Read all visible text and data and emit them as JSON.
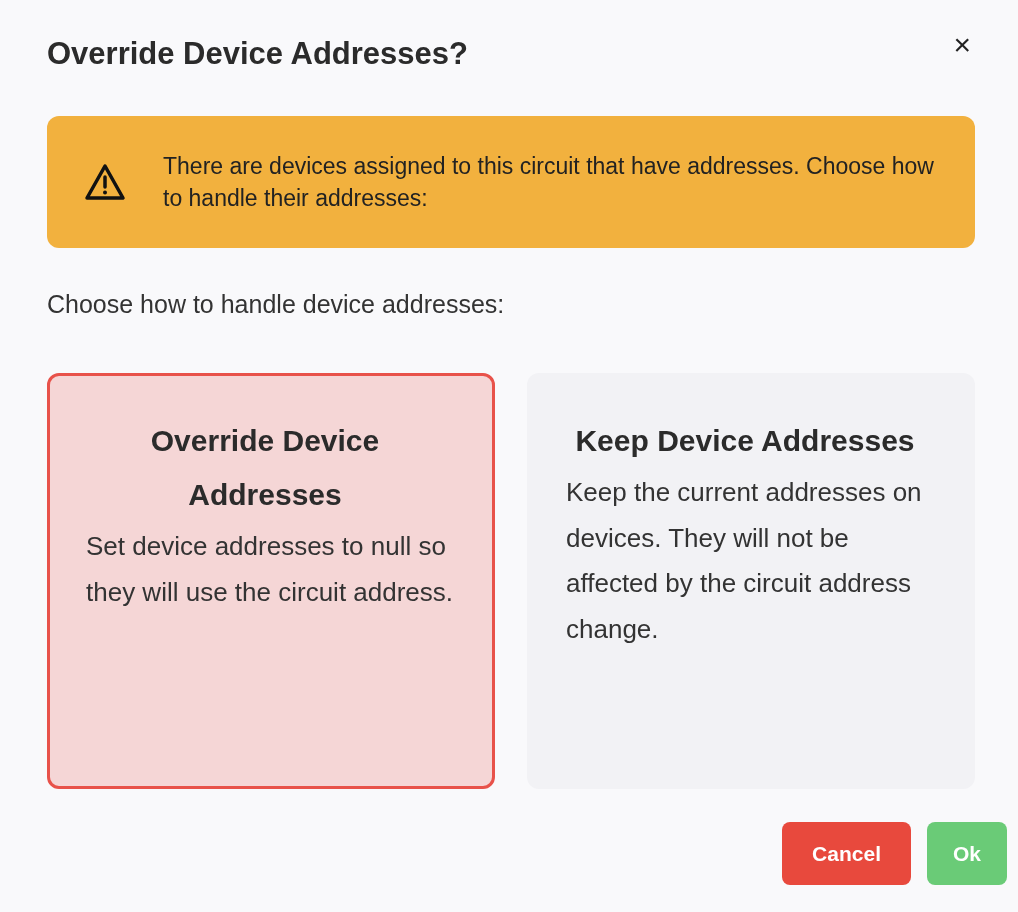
{
  "dialog": {
    "title": "Override Device Addresses?",
    "close": "×"
  },
  "warning": {
    "text": "There are devices assigned to this circuit that have addresses. Choose how to handle their addresses:"
  },
  "prompt": "Choose how to handle device addresses:",
  "options": [
    {
      "title": "Override Device Addresses",
      "description": "Set device addresses to null so they will use the circuit address.",
      "selected": true
    },
    {
      "title": "Keep Device Addresses",
      "description": "Keep the current addresses on devices. They will not be affected by the circuit address change.",
      "selected": false
    }
  ],
  "buttons": [
    {
      "label": "Cancel",
      "kind": "danger"
    },
    {
      "label": "Ok",
      "kind": "confirm"
    }
  ]
}
